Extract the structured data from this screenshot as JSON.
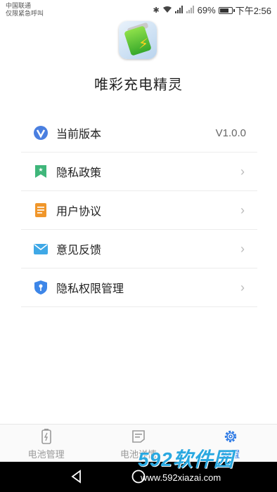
{
  "status_bar": {
    "carrier_line1": "中国联通",
    "carrier_line2": "仅限紧急呼叫",
    "battery_percent": "69%",
    "time": "下午2:56"
  },
  "app": {
    "name": "唯彩充电精灵",
    "icon": "battery-charging-app-icon"
  },
  "settings_list": [
    {
      "label": "当前版本",
      "value": "V1.0.0",
      "icon": "v-logo-icon",
      "icon_color": "#4a7fe0"
    },
    {
      "label": "隐私政策",
      "icon": "bookmark-star-icon",
      "icon_color": "#3fb67a"
    },
    {
      "label": "用户协议",
      "icon": "document-icon",
      "icon_color": "#f0962a"
    },
    {
      "label": "意见反馈",
      "icon": "mail-icon",
      "icon_color": "#3fa8e6"
    },
    {
      "label": "隐私权限管理",
      "icon": "shield-key-icon",
      "icon_color": "#3d86e8"
    }
  ],
  "tabs": [
    {
      "label": "电池管理",
      "icon": "battery-icon",
      "active": false
    },
    {
      "label": "电池详情",
      "icon": "list-note-icon",
      "active": false
    },
    {
      "label": "设置",
      "icon": "gear-icon",
      "active": true
    }
  ],
  "watermark": {
    "brand": "592软件园",
    "url": "www.592xiazai.com"
  },
  "colors": {
    "accent": "#2f7be5",
    "inactive_tab": "#9a9a9a"
  }
}
